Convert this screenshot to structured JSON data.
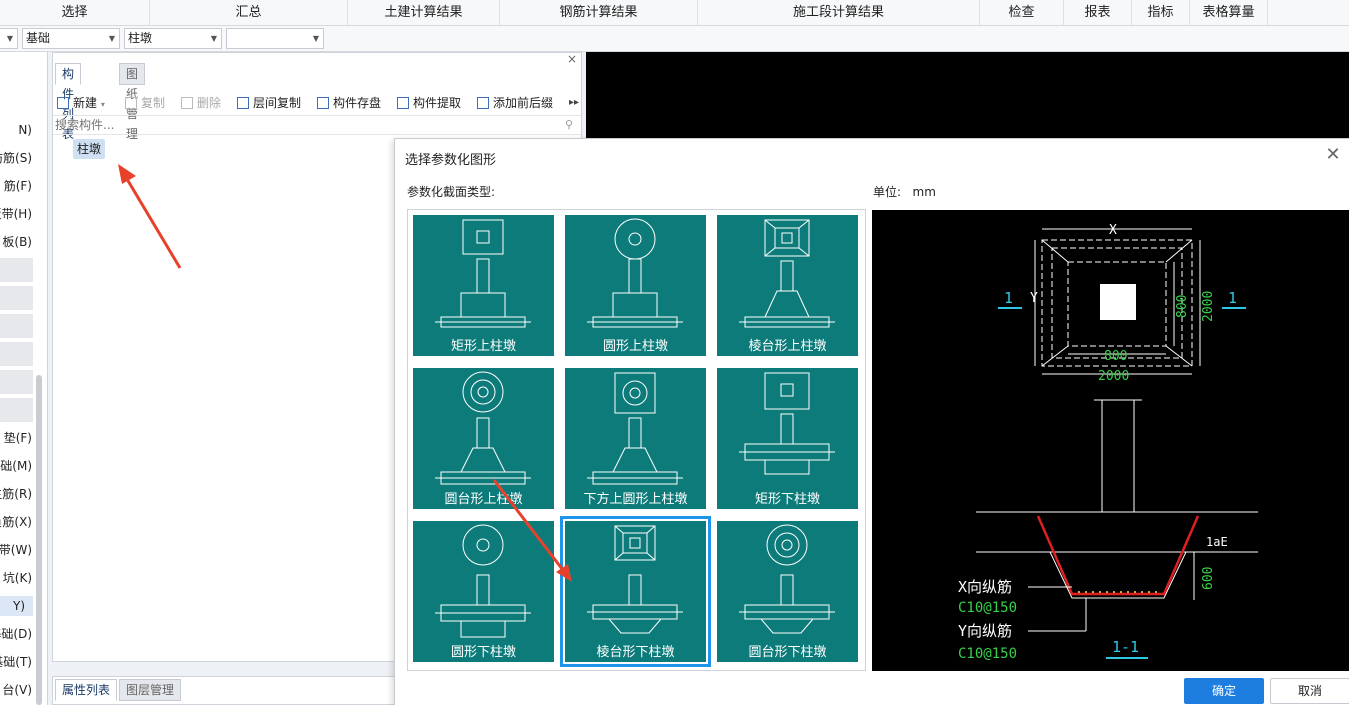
{
  "menu": [
    "选择",
    "汇总",
    "土建计算结果",
    "钢筋计算结果",
    "施工段计算结果",
    "检查",
    "报表",
    "指标",
    "表格算量"
  ],
  "filters": {
    "combo1": "",
    "combo2": "基础",
    "combo3": "柱墩",
    "combo4": ""
  },
  "left_tree": [
    "N)",
    "防筋(S)",
    "筋(F)",
    "板带(H)",
    "板(B)",
    "垫(F)",
    "基础(M)",
    "主筋(R)",
    "负筋(X)",
    "板带(W)",
    "坑(K)",
    "Y)",
    "基础(D)",
    "基础(T)",
    "台(V)"
  ],
  "component_panel": {
    "tab_active": "构件列表",
    "tab_inactive": "图纸管理",
    "toolbar": {
      "new": "新建",
      "copy": "复制",
      "delete": "删除",
      "floor_copy": "层间复制",
      "save": "构件存盘",
      "extract": "构件提取",
      "add_prefix": "添加前后缀"
    },
    "search_placeholder": "搜索构件...",
    "item": "柱墩"
  },
  "prop_panel": {
    "tab_active": "属性列表",
    "tab_inactive": "图层管理"
  },
  "dialog": {
    "title": "选择参数化图形",
    "section_label": "参数化截面类型:",
    "unit_label": "单位:",
    "unit_value": "mm",
    "shapes": [
      "矩形上柱墩",
      "圆形上柱墩",
      "棱台形上柱墩",
      "圆台形上柱墩",
      "下方上圆形上柱墩",
      "矩形下柱墩",
      "圆形下柱墩",
      "棱台形下柱墩",
      "圆台形下柱墩"
    ],
    "selected_index": 7,
    "ok": "确定",
    "cancel": "取消"
  },
  "preview": {
    "x_label": "X",
    "y_label": "Y",
    "dim_800_h": "800",
    "dim_2000_h": "2000",
    "dim_800_v": "800",
    "dim_2000_v": "2000",
    "section_mark": "1",
    "lae": "1aE",
    "dim_600": "600",
    "x_bar_label": "X向纵筋",
    "x_bar_spec": "C10@150",
    "y_bar_label": "Y向纵筋",
    "y_bar_spec": "C10@150",
    "section_title": "1-1"
  },
  "colors": {
    "teal": "#0e7b7b",
    "accent": "#1d7ee0",
    "dim_green": "#38d24a",
    "dim_cyan": "#2ec7e6",
    "rebar_red": "#e02020"
  }
}
